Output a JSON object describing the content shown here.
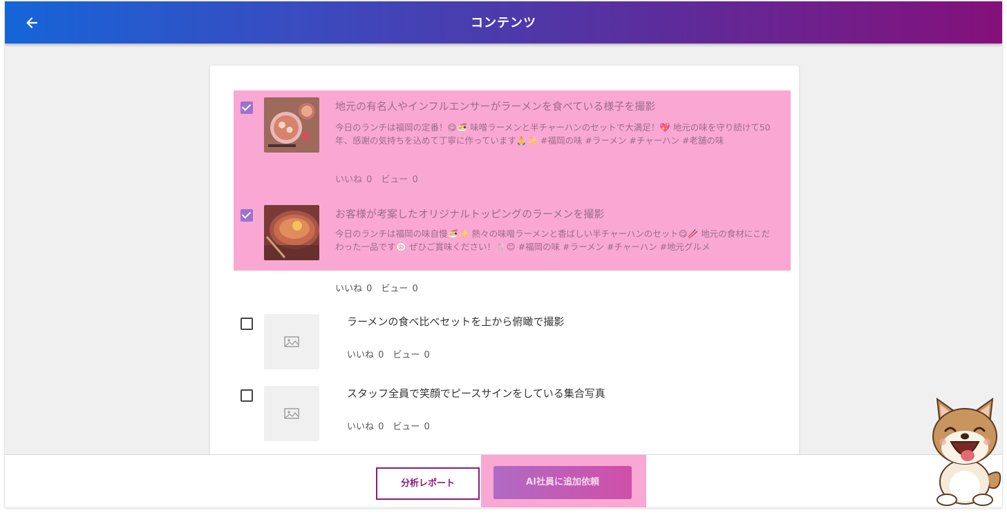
{
  "header": {
    "title": "コンテンツ"
  },
  "items": [
    {
      "checked": true,
      "title": "地元の有名人やインフルエンサーがラーメンを食べている様子を撮影",
      "description": "今日のランチは福岡の定番！😋🍜 味噌ラーメンと半チャーハンのセットで大満足！💖 地元の味を守り続けて50年、感謝の気持ちを込めて丁寧に作っています🙏✨ #福岡の味 #ラーメン #チャーハン #老舗の味",
      "stats": "いいね 0　ビュー 0"
    },
    {
      "checked": true,
      "title": "お客様が考案したオリジナルトッピングのラーメンを撮影",
      "description": "今日のランチは福岡の味自慢🍜✨ 熱々の味噌ラーメンと香ばしい半チャーハンのセット😋🥢 地元の食材にこだわった一品です🍥 ぜひご賞味ください！🍴😊 #福岡の味 #ラーメン #チャーハン #地元グルメ",
      "stats": "いいね 0　ビュー 0"
    },
    {
      "checked": false,
      "title": "ラーメンの食べ比べセットを上から俯瞰で撮影",
      "description": "",
      "stats": "いいね 0　ビュー 0"
    },
    {
      "checked": false,
      "title": "スタッフ全員で笑顔でピースサインをしている集合写真",
      "description": "",
      "stats": "いいね 0　ビュー 0"
    }
  ],
  "footer": {
    "report_label": "分析レポート",
    "ai_request_label": "AI社員に追加依頼"
  },
  "icons": {
    "back": "arrow-left-icon",
    "placeholder": "image-placeholder-icon",
    "mascot": "shiba-dog-mascot"
  },
  "colors": {
    "header_gradient_start": "#1565d8",
    "header_gradient_end": "#85107a",
    "selection_highlight": "#f9a8d4",
    "checkbox_checked": "#9b72d0",
    "report_button": "#8b1a7a"
  }
}
